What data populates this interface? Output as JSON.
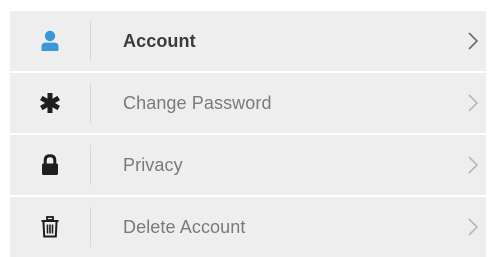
{
  "menu": {
    "items": [
      {
        "label": "Account",
        "icon": "user-icon",
        "active": true
      },
      {
        "label": "Change Password",
        "icon": "asterisk-icon",
        "active": false
      },
      {
        "label": "Privacy",
        "icon": "lock-icon",
        "active": false
      },
      {
        "label": "Delete Account",
        "icon": "trash-icon",
        "active": false
      }
    ]
  },
  "colors": {
    "row_background": "#eeeeee",
    "user_icon": "#3b98d8",
    "dark_icon": "#1e1e1e",
    "chevron_active": "#6b6b6b",
    "chevron_inactive": "#b8b8b8",
    "label_active": "#3a3a3a",
    "label_inactive": "#7a7a7a"
  }
}
